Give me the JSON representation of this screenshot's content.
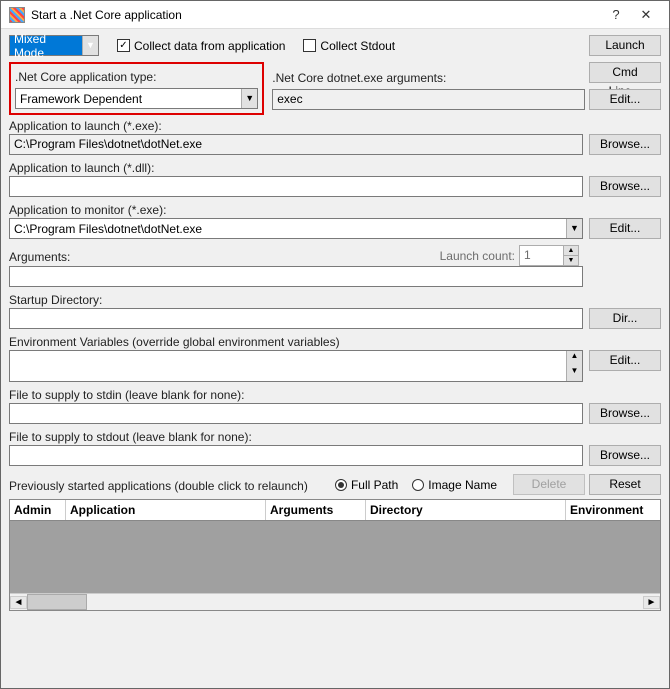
{
  "window": {
    "title": "Start a .Net Core application",
    "help": "?",
    "close": "✕"
  },
  "toprow": {
    "mode": "Mixed Mode",
    "collect_data": "Collect data from application",
    "collect_stdout": "Collect Stdout",
    "launch": "Launch",
    "cmdline": "Cmd Line..."
  },
  "apptype": {
    "label": ".Net Core application type:",
    "value": "Framework Dependent",
    "args_label": ".Net Core dotnet.exe arguments:",
    "args_value": "exec",
    "edit": "Edit..."
  },
  "launch_exe": {
    "label": "Application to launch (*.exe):",
    "value": "C:\\Program Files\\dotnet\\dotNet.exe",
    "btn": "Browse..."
  },
  "launch_dll": {
    "label": "Application to launch (*.dll):",
    "value": "",
    "btn": "Browse..."
  },
  "monitor": {
    "label": "Application to monitor (*.exe):",
    "value": "C:\\Program Files\\dotnet\\dotNet.exe",
    "btn": "Edit..."
  },
  "args": {
    "label": "Arguments:",
    "launch_count_label": "Launch count:",
    "launch_count": "1",
    "value": ""
  },
  "startup": {
    "label": "Startup Directory:",
    "value": "",
    "btn": "Dir..."
  },
  "env": {
    "label": "Environment Variables (override global environment variables)",
    "btn": "Edit..."
  },
  "stdin": {
    "label": "File to supply to stdin (leave blank for none):",
    "value": "",
    "btn": "Browse..."
  },
  "stdout": {
    "label": "File to supply to stdout (leave blank for none):",
    "value": "",
    "btn": "Browse..."
  },
  "prev": {
    "label": "Previously started applications (double click to relaunch)",
    "fullpath": "Full Path",
    "imgname": "Image Name",
    "delete": "Delete",
    "reset": "Reset",
    "cols": {
      "admin": "Admin",
      "app": "Application",
      "args": "Arguments",
      "dir": "Directory",
      "env": "Environment"
    }
  }
}
